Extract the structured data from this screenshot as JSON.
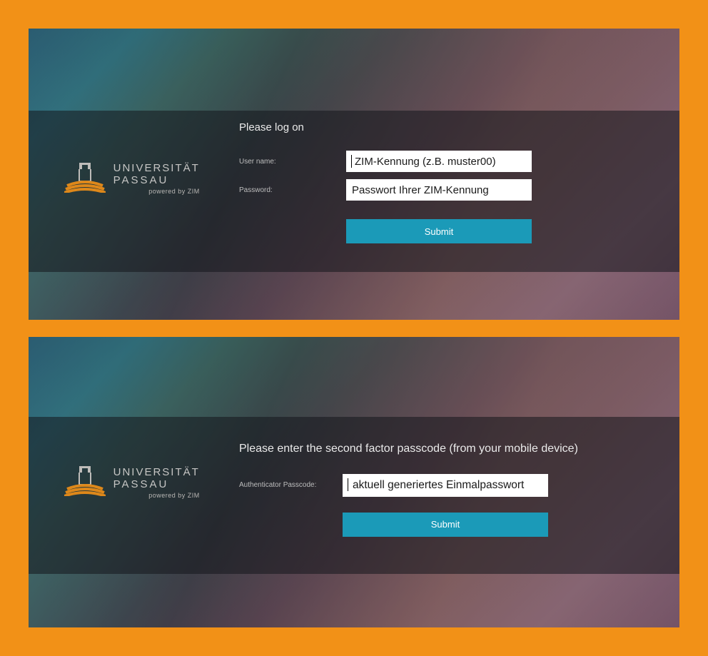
{
  "logo": {
    "line1": "UNIVERSITÄT",
    "line2": "PASSAU",
    "sub": "powered by ZIM"
  },
  "panel1": {
    "heading": "Please log on",
    "username_label": "User name:",
    "password_label": "Password:",
    "username_value": "ZIM-Kennung (z.B. muster00)",
    "password_value": "Passwort Ihrer ZIM-Kennung",
    "submit_label": "Submit"
  },
  "panel2": {
    "heading": "Please enter the second factor passcode (from your mobile device)",
    "passcode_label": "Authenticator Passcode:",
    "passcode_value": "aktuell generiertes Einmalpasswort",
    "submit_label": "Submit"
  },
  "colors": {
    "frame": "#f29117",
    "submit": "#1b9ab8"
  }
}
